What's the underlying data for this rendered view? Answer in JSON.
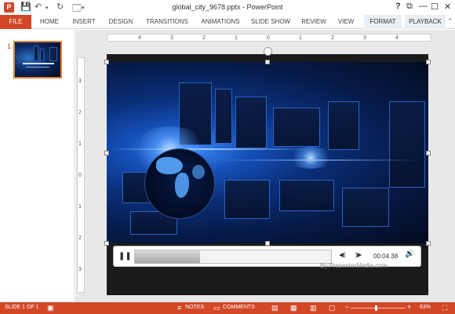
{
  "window": {
    "title": "global_city_9678.pptx - PowerPoint",
    "app_logo": "P",
    "help": "?",
    "controls": [
      "⧉",
      "—",
      "☐",
      "✕"
    ]
  },
  "quick_access": {
    "save_icon": "save-icon",
    "undo_icon": "undo-icon",
    "redo_icon": "redo-icon",
    "presenter_icon": "presenter-icon"
  },
  "ribbon": {
    "tabs": [
      "FILE",
      "HOME",
      "INSERT",
      "DESIGN",
      "TRANSITIONS",
      "ANIMATIONS",
      "SLIDE SHOW",
      "REVIEW",
      "VIEW",
      "FORMAT",
      "PLAYBACK"
    ],
    "active_tab": "PLAYBACK",
    "accent_color": "#d24726"
  },
  "thumbnails": {
    "items": [
      {
        "number": "1"
      }
    ]
  },
  "rulers": {
    "horizontal": [
      "4",
      "3",
      "2",
      "1",
      "0",
      "1",
      "2",
      "3",
      "4"
    ],
    "vertical": [
      "3",
      "2",
      "1",
      "0",
      "1",
      "2",
      "3"
    ]
  },
  "player": {
    "pause_label": "❚❚",
    "prev_label": "◀|",
    "next_label": "|▶",
    "timecode": "00:04.38",
    "volume_icon": "volume-icon",
    "progress_fraction": 0.33
  },
  "slide": {
    "watermark": "By PresenterMedia.com"
  },
  "statusbar": {
    "slide_info": "SLIDE 1 OF 1",
    "notes": "NOTES",
    "comments": "COMMENTS",
    "zoom": "63%",
    "minus": "−",
    "plus": "+"
  }
}
